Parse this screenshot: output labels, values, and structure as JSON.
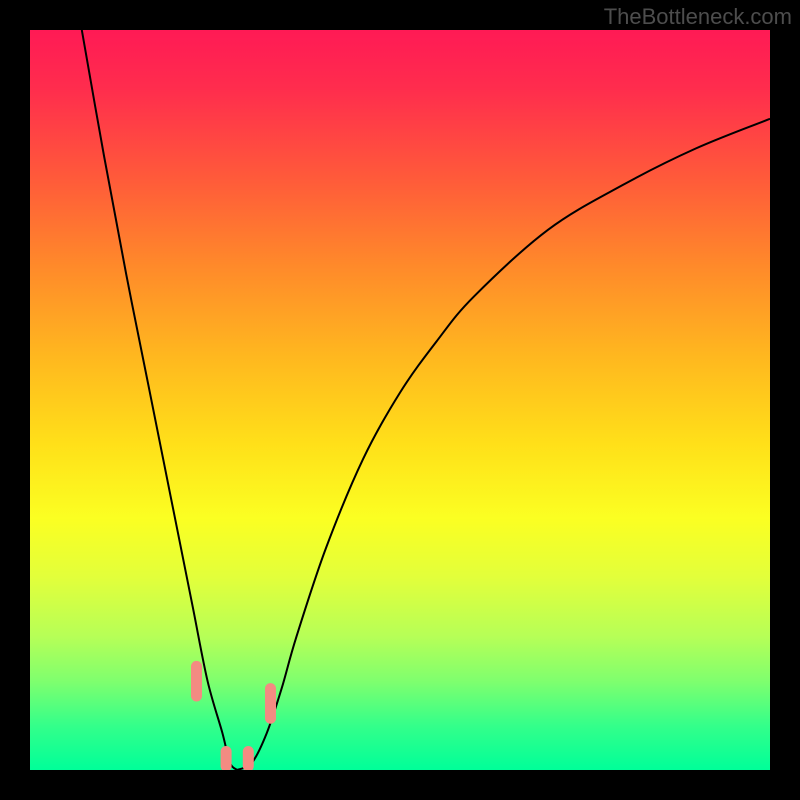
{
  "watermark": "TheBottleneck.com",
  "colors": {
    "frame": "#000000",
    "curve": "#000000",
    "marker": "#f38b82",
    "gradient_top": "#ff1a55",
    "gradient_bottom": "#00ff99"
  },
  "chart_data": {
    "type": "line",
    "title": "",
    "xlabel": "",
    "ylabel": "",
    "xlim": [
      0,
      100
    ],
    "ylim": [
      0,
      100
    ],
    "x": [
      7,
      10,
      13,
      16,
      18,
      20,
      22,
      24,
      26,
      27,
      28,
      30,
      32,
      34,
      36,
      40,
      45,
      50,
      55,
      60,
      70,
      80,
      90,
      100
    ],
    "y": [
      100,
      83,
      67,
      52,
      42,
      32,
      22,
      12,
      5,
      1,
      0,
      1,
      5,
      11,
      18,
      30,
      42,
      51,
      58,
      64,
      73,
      79,
      84,
      88
    ],
    "notes": "V-shaped curve; minimum at roughly x≈28, y≈0. Background is a vertical heat gradient (red top → green bottom). No axis ticks or labels are drawn.",
    "markers": [
      {
        "x": 22.5,
        "y1": 10,
        "y2": 14
      },
      {
        "x": 26.5,
        "y1": 0.5,
        "y2": 2.5
      },
      {
        "x": 29.5,
        "y1": 0.5,
        "y2": 2.5
      },
      {
        "x": 32.5,
        "y1": 7,
        "y2": 11
      }
    ]
  }
}
